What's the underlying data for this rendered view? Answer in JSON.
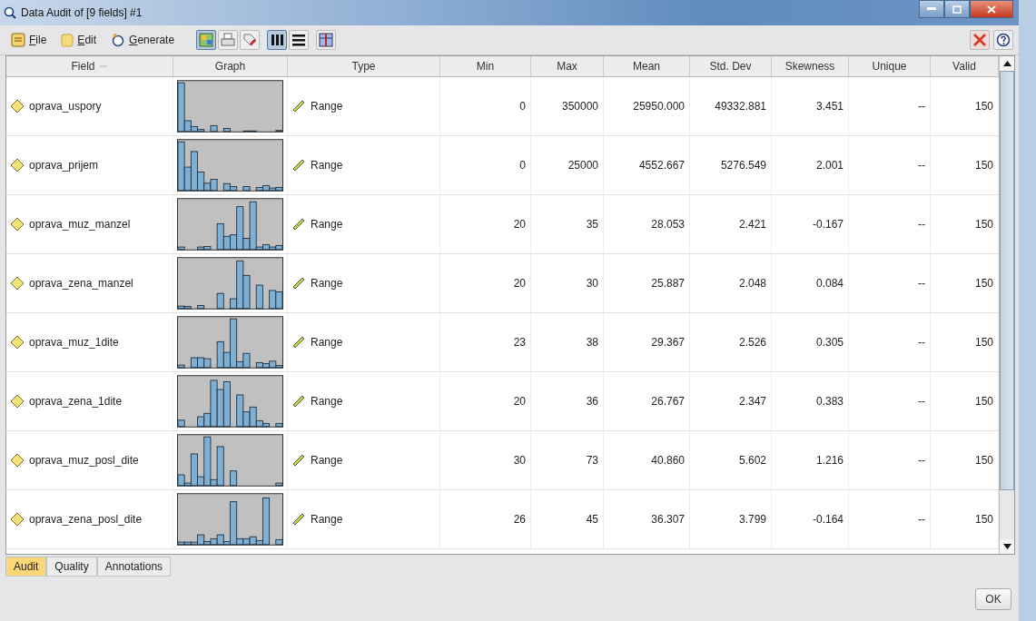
{
  "window": {
    "title": "Data Audit of [9 fields] #1"
  },
  "toolbar": {
    "menus": [
      "File",
      "Edit",
      "Generate"
    ],
    "view_buttons": [
      {
        "kind": "graph",
        "selected": true
      },
      {
        "kind": "print",
        "selected": false
      },
      {
        "kind": "tag",
        "selected": false
      },
      {
        "kind": "columns",
        "selected": true
      },
      {
        "kind": "rows",
        "selected": false
      },
      {
        "kind": "table",
        "selected": false
      }
    ]
  },
  "table": {
    "columns": [
      "Field",
      "Graph",
      "Type",
      "Min",
      "Max",
      "Mean",
      "Std. Dev",
      "Skewness",
      "Unique",
      "Valid"
    ],
    "rows": [
      {
        "field": "oprava_uspory",
        "type": "Range",
        "min": "0",
        "max": "350000",
        "mean": "25950.000",
        "std_dev": "49332.881",
        "skewness": "3.451",
        "unique": "--",
        "valid": "150"
      },
      {
        "field": "oprava_prijem",
        "type": "Range",
        "min": "0",
        "max": "25000",
        "mean": "4552.667",
        "std_dev": "5276.549",
        "skewness": "2.001",
        "unique": "--",
        "valid": "150"
      },
      {
        "field": "oprava_muz_manzel",
        "type": "Range",
        "min": "20",
        "max": "35",
        "mean": "28.053",
        "std_dev": "2.421",
        "skewness": "-0.167",
        "unique": "--",
        "valid": "150"
      },
      {
        "field": "oprava_zena_manzel",
        "type": "Range",
        "min": "20",
        "max": "30",
        "mean": "25.887",
        "std_dev": "2.048",
        "skewness": "0.084",
        "unique": "--",
        "valid": "150"
      },
      {
        "field": "oprava_muz_1dite",
        "type": "Range",
        "min": "23",
        "max": "38",
        "mean": "29.367",
        "std_dev": "2.526",
        "skewness": "0.305",
        "unique": "--",
        "valid": "150"
      },
      {
        "field": "oprava_zena_1dite",
        "type": "Range",
        "min": "20",
        "max": "36",
        "mean": "26.767",
        "std_dev": "2.347",
        "skewness": "0.383",
        "unique": "--",
        "valid": "150"
      },
      {
        "field": "oprava_muz_posl_dite",
        "type": "Range",
        "min": "30",
        "max": "73",
        "mean": "40.860",
        "std_dev": "5.602",
        "skewness": "1.216",
        "unique": "--",
        "valid": "150"
      },
      {
        "field": "oprava_zena_posl_dite",
        "type": "Range",
        "min": "26",
        "max": "45",
        "mean": "36.307",
        "std_dev": "3.799",
        "skewness": "-0.164",
        "unique": "--",
        "valid": "150"
      }
    ]
  },
  "tabs": [
    {
      "label": "Audit",
      "selected": true
    },
    {
      "label": "Quality",
      "selected": false
    },
    {
      "label": "Annotations",
      "selected": false
    }
  ],
  "buttons": [
    "OK"
  ]
}
